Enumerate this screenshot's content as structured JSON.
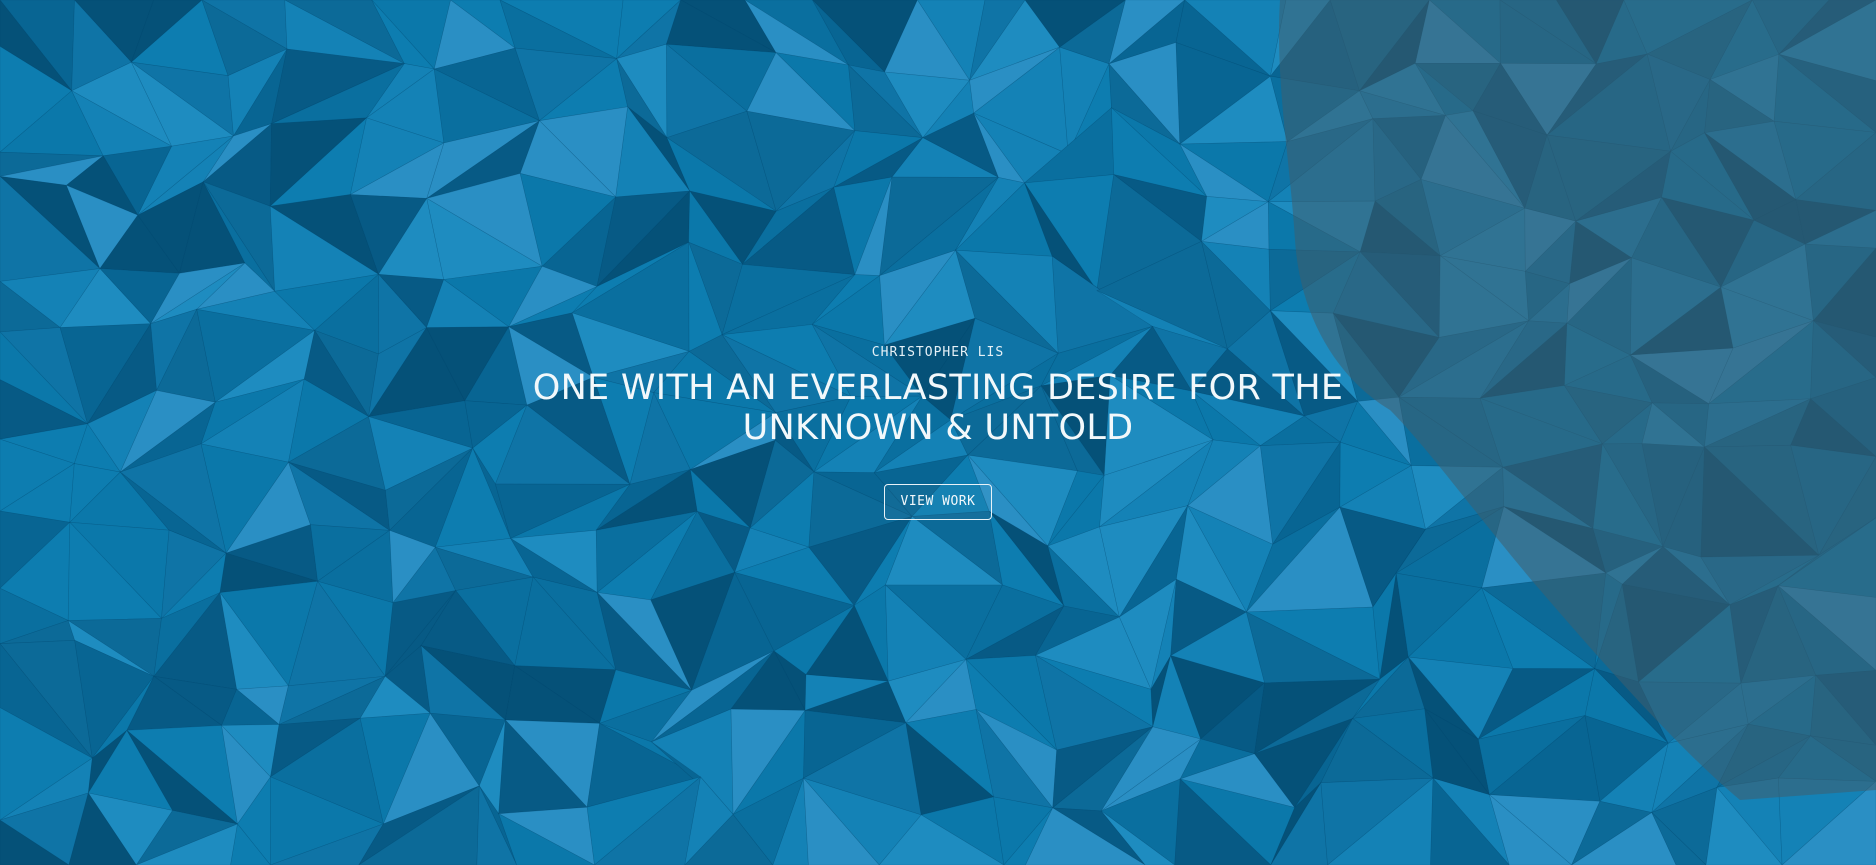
{
  "hero": {
    "eyebrow": "CHRISTOPHER LIS",
    "headline": "ONE WITH AN EVERLASTING DESIRE FOR THE UNKNOWN & UNTOLD",
    "cta_label": "VIEW WORK"
  },
  "colors": {
    "base": "#0b78aa",
    "light": "#2a8fc4",
    "dark": "#055a85",
    "deep": "#024466",
    "overlay": "#3b5e70"
  }
}
